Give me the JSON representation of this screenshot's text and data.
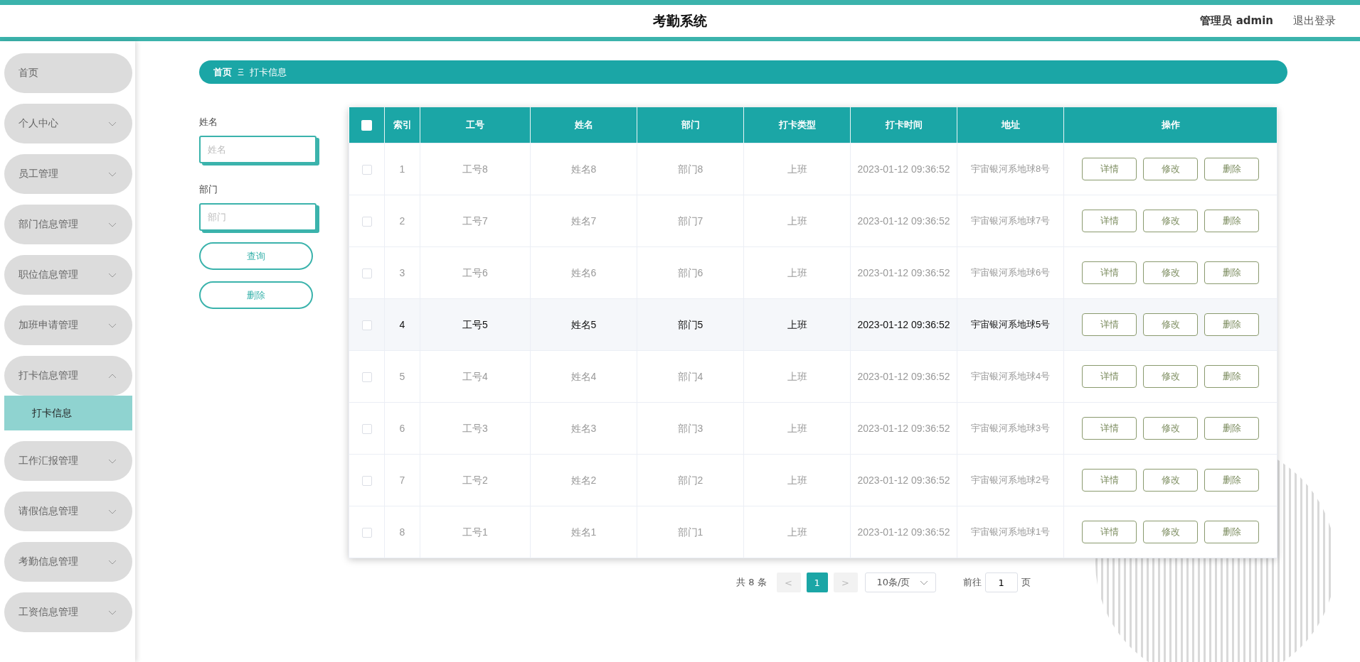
{
  "header": {
    "title": "考勤系统",
    "user": "管理员 admin",
    "logout": "退出登录"
  },
  "sidebar": {
    "items": [
      {
        "kind": "link",
        "label": "首页"
      },
      {
        "kind": "menu",
        "label": "个人中心",
        "expanded": false
      },
      {
        "kind": "menu",
        "label": "员工管理",
        "expanded": false
      },
      {
        "kind": "menu",
        "label": "部门信息管理",
        "expanded": false
      },
      {
        "kind": "menu",
        "label": "职位信息管理",
        "expanded": false
      },
      {
        "kind": "menu",
        "label": "加班申请管理",
        "expanded": false
      },
      {
        "kind": "menu",
        "label": "打卡信息管理",
        "expanded": true,
        "children": [
          {
            "label": "打卡信息",
            "selected": true
          }
        ]
      },
      {
        "kind": "menu",
        "label": "工作汇报管理",
        "expanded": false
      },
      {
        "kind": "menu",
        "label": "请假信息管理",
        "expanded": false
      },
      {
        "kind": "menu",
        "label": "考勤信息管理",
        "expanded": false
      },
      {
        "kind": "menu",
        "label": "工资信息管理",
        "expanded": false
      }
    ]
  },
  "breadcrumb": [
    "首页",
    "打卡信息"
  ],
  "search": {
    "fields": [
      {
        "label": "姓名",
        "placeholder": "姓名"
      },
      {
        "label": "部门",
        "placeholder": "部门"
      }
    ],
    "buttons": [
      "查询",
      "删除"
    ]
  },
  "table": {
    "select_all": {
      "checked": false
    },
    "columns": [
      "索引",
      "工号",
      "姓名",
      "部门",
      "打卡类型",
      "打卡时间",
      "地址",
      "操作"
    ],
    "rows": [
      {
        "checked": false,
        "hovered": false,
        "cells": [
          "1",
          "工号8",
          "姓名8",
          "部门8",
          "上班",
          "2023-01-12 09:36:52",
          "宇宙银河系地球8号"
        ],
        "actions": [
          "详情",
          "修改",
          "删除"
        ]
      },
      {
        "checked": false,
        "hovered": false,
        "cells": [
          "2",
          "工号7",
          "姓名7",
          "部门7",
          "上班",
          "2023-01-12 09:36:52",
          "宇宙银河系地球7号"
        ],
        "actions": [
          "详情",
          "修改",
          "删除"
        ]
      },
      {
        "checked": false,
        "hovered": false,
        "cells": [
          "3",
          "工号6",
          "姓名6",
          "部门6",
          "上班",
          "2023-01-12 09:36:52",
          "宇宙银河系地球6号"
        ],
        "actions": [
          "详情",
          "修改",
          "删除"
        ]
      },
      {
        "checked": false,
        "hovered": true,
        "cells": [
          "4",
          "工号5",
          "姓名5",
          "部门5",
          "上班",
          "2023-01-12 09:36:52",
          "宇宙银河系地球5号"
        ],
        "actions": [
          "详情",
          "修改",
          "删除"
        ]
      },
      {
        "checked": false,
        "hovered": false,
        "cells": [
          "5",
          "工号4",
          "姓名4",
          "部门4",
          "上班",
          "2023-01-12 09:36:52",
          "宇宙银河系地球4号"
        ],
        "actions": [
          "详情",
          "修改",
          "删除"
        ]
      },
      {
        "checked": false,
        "hovered": false,
        "cells": [
          "6",
          "工号3",
          "姓名3",
          "部门3",
          "上班",
          "2023-01-12 09:36:52",
          "宇宙银河系地球3号"
        ],
        "actions": [
          "详情",
          "修改",
          "删除"
        ]
      },
      {
        "checked": false,
        "hovered": false,
        "cells": [
          "7",
          "工号2",
          "姓名2",
          "部门2",
          "上班",
          "2023-01-12 09:36:52",
          "宇宙银河系地球2号"
        ],
        "actions": [
          "详情",
          "修改",
          "删除"
        ]
      },
      {
        "checked": false,
        "hovered": false,
        "cells": [
          "8",
          "工号1",
          "姓名1",
          "部门1",
          "上班",
          "2023-01-12 09:36:52",
          "宇宙银河系地球1号"
        ],
        "actions": [
          "详情",
          "修改",
          "删除"
        ]
      }
    ]
  },
  "pagination": {
    "total": "共 8 条",
    "prev": "<",
    "pages": [
      {
        "label": "1",
        "selected": true
      }
    ],
    "next": ">",
    "page_size": "10条/页",
    "goto_label": "前往",
    "goto_value": "1",
    "goto_suffix": "页"
  }
}
